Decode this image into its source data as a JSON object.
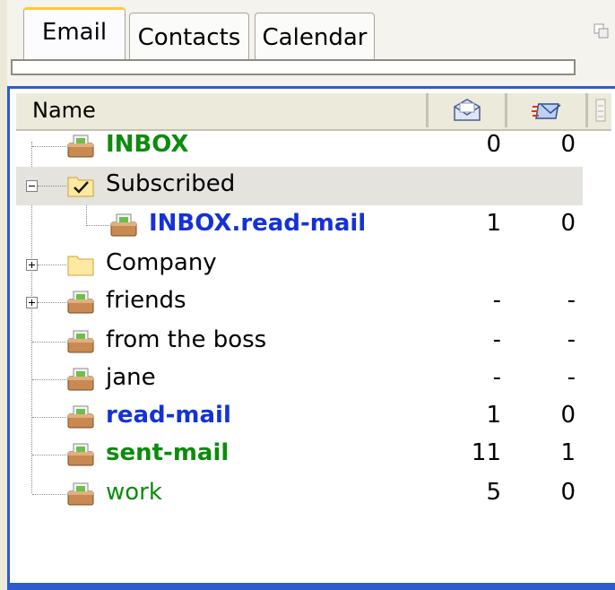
{
  "tabs": [
    {
      "label": "Email",
      "active": true
    },
    {
      "label": "Contacts",
      "active": false
    },
    {
      "label": "Calendar",
      "active": false
    }
  ],
  "columns": {
    "name": "Name",
    "unread_icon": "envelope-read-icon",
    "new_icon": "envelope-new-icon"
  },
  "folders": [
    {
      "name": "INBOX",
      "unread": "0",
      "total": "0",
      "style": "green-bold",
      "icon": "mailbox-icon"
    },
    {
      "name": "Subscribed",
      "unread": "",
      "total": "",
      "style": "black",
      "icon": "checked-folder-icon",
      "expanded": true,
      "selected": true
    },
    {
      "name": "INBOX.read-mail",
      "unread": "1",
      "total": "0",
      "style": "blue-bold",
      "icon": "mailbox-icon"
    },
    {
      "name": "Company",
      "unread": "",
      "total": "",
      "style": "black",
      "icon": "folder-icon",
      "expandable": true
    },
    {
      "name": "friends",
      "unread": "-",
      "total": "-",
      "style": "black",
      "icon": "mailbox-icon",
      "expandable": true
    },
    {
      "name": "from the boss",
      "unread": "-",
      "total": "-",
      "style": "black",
      "icon": "mailbox-icon"
    },
    {
      "name": "jane",
      "unread": "-",
      "total": "-",
      "style": "black",
      "icon": "mailbox-icon"
    },
    {
      "name": "read-mail",
      "unread": "1",
      "total": "0",
      "style": "blue-bold",
      "icon": "mailbox-icon"
    },
    {
      "name": "sent-mail",
      "unread": "11",
      "total": "1",
      "style": "green-bold",
      "icon": "mailbox-icon"
    },
    {
      "name": "work",
      "unread": "5",
      "total": "0",
      "style": "green",
      "icon": "mailbox-icon"
    }
  ],
  "colors": {
    "accent": "#2c5ccc",
    "green": "#0b8c0b",
    "blue": "#1432d8",
    "tab_highlight": "#ffc83c"
  }
}
